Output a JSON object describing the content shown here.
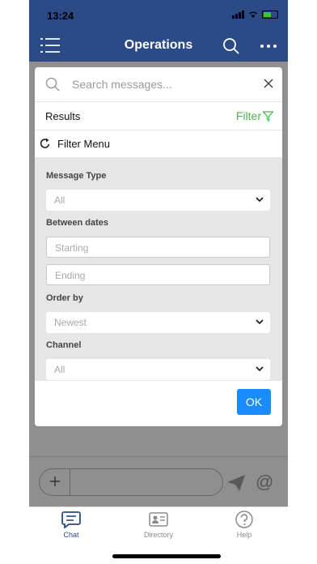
{
  "status_bar": {
    "time": "13:24"
  },
  "header": {
    "title": "Operations",
    "icons": [
      "list-menu-icon",
      "search-icon",
      "more-dots-icon"
    ]
  },
  "search": {
    "placeholder": "Search messages..."
  },
  "results_bar": {
    "label": "Results",
    "filter_label": "Filter"
  },
  "filter_menu": {
    "label": "Filter Menu",
    "message_type": {
      "label": "Message Type",
      "value": "All"
    },
    "between_dates": {
      "label": "Between dates",
      "start_placeholder": "Starting",
      "end_placeholder": "Ending"
    },
    "order_by": {
      "label": "Order by",
      "value": "Newest"
    },
    "channel": {
      "label": "Channel",
      "value": "All"
    },
    "ok_label": "OK"
  },
  "composer": {
    "at_symbol": "@"
  },
  "tabs": [
    {
      "label": "Chat",
      "icon": "chat-icon",
      "active": true
    },
    {
      "label": "Directory",
      "icon": "contact-card-icon",
      "active": false
    },
    {
      "label": "Help",
      "icon": "help-icon",
      "active": false
    }
  ],
  "colors": {
    "header": "#2b4a86",
    "accent_green": "#4db34d",
    "ok_button": "#1a8cff",
    "overlay": "#8f8f8f"
  }
}
